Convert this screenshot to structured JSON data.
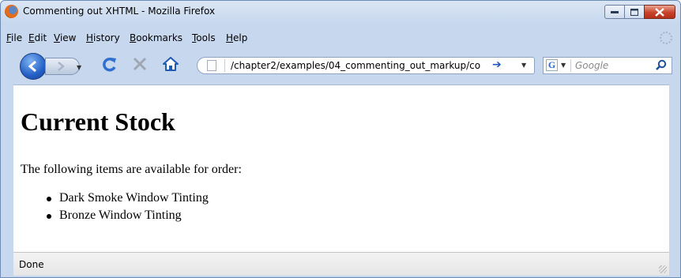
{
  "window": {
    "title": "Commenting out XHTML - Mozilla Firefox"
  },
  "menu": {
    "items": [
      "File",
      "Edit",
      "View",
      "History",
      "Bookmarks",
      "Tools",
      "Help"
    ]
  },
  "nav": {
    "url": "/chapter2/examples/04_commenting_out_markup/co",
    "search_placeholder": "Google"
  },
  "content": {
    "heading": "Current Stock",
    "intro": "The following items are available for order:",
    "items": [
      "Dark Smoke Window Tinting",
      "Bronze Window Tinting"
    ]
  },
  "status": {
    "text": "Done"
  },
  "colors": {
    "accent": "#2560c7",
    "close": "#c9432a"
  }
}
